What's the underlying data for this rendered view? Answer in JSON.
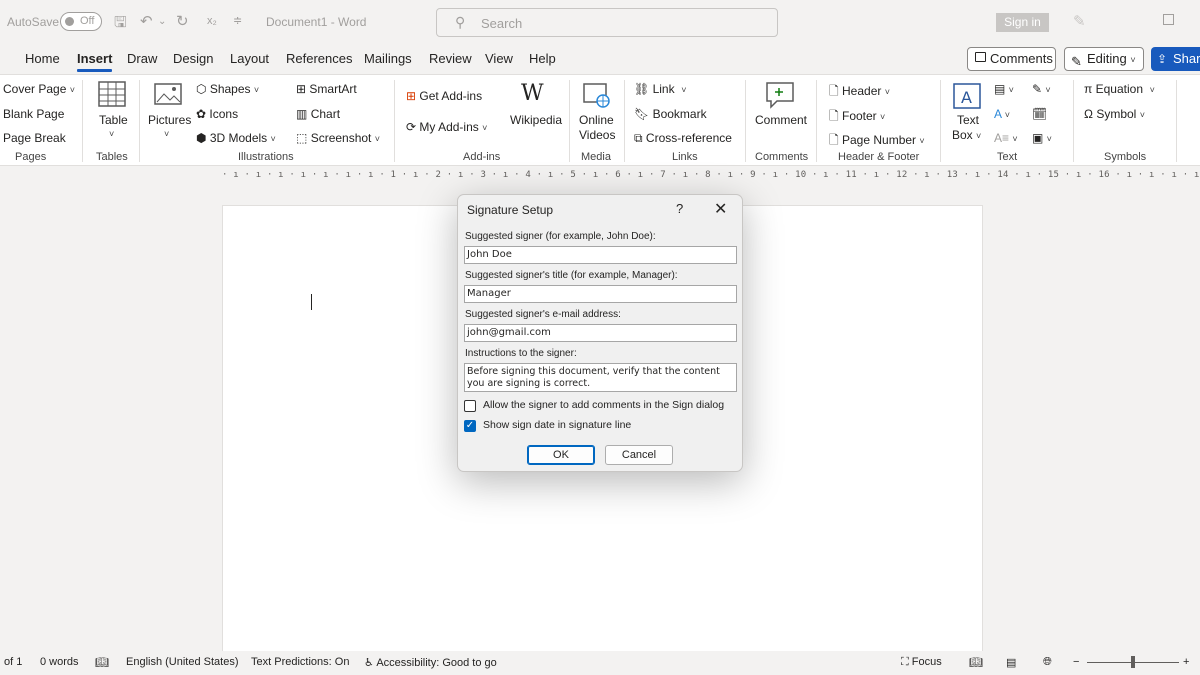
{
  "titlebar": {
    "autosave_label": "AutoSave",
    "autosave_state": "Off",
    "document_title": "Document1 - Word",
    "search_placeholder": "Search",
    "signin_label": "Sign in"
  },
  "tabs": [
    {
      "label": "Home"
    },
    {
      "label": "Insert",
      "active": true
    },
    {
      "label": "Draw"
    },
    {
      "label": "Design"
    },
    {
      "label": "Layout"
    },
    {
      "label": "References"
    },
    {
      "label": "Mailings"
    },
    {
      "label": "Review"
    },
    {
      "label": "View"
    },
    {
      "label": "Help"
    }
  ],
  "header_buttons": {
    "comments": "Comments",
    "editing": "Editing",
    "share": "Share"
  },
  "ribbon": {
    "pages": {
      "group": "Pages",
      "cover_page": "Cover Page",
      "blank_page": "Blank Page",
      "page_break": "Page Break"
    },
    "tables": {
      "group": "Tables",
      "table": "Table"
    },
    "illustrations": {
      "group": "Illustrations",
      "pictures": "Pictures",
      "shapes": "Shapes",
      "icons": "Icons",
      "models_3d": "3D Models",
      "smartart": "SmartArt",
      "chart": "Chart",
      "screenshot": "Screenshot"
    },
    "addins": {
      "group": "Add-ins",
      "get_addins": "Get Add-ins",
      "my_addins": "My Add-ins",
      "wikipedia": "Wikipedia"
    },
    "media": {
      "group": "Media",
      "online_videos_1": "Online",
      "online_videos_2": "Videos"
    },
    "links": {
      "group": "Links",
      "link": "Link",
      "bookmark": "Bookmark",
      "cross_reference": "Cross-reference"
    },
    "comments": {
      "group": "Comments",
      "comment": "Comment"
    },
    "header_footer": {
      "group": "Header & Footer",
      "header": "Header",
      "footer": "Footer",
      "page_number": "Page Number"
    },
    "text": {
      "group": "Text",
      "text_box_1": "Text",
      "text_box_2": "Box"
    },
    "symbols": {
      "group": "Symbols",
      "equation": "Equation",
      "symbol": "Symbol"
    }
  },
  "ruler": {
    "text": "· ı · ı · ı · ı · ı · ı · ı · 1 · ı · 2 · ı · 3 · ı · 4 · ı · 5 · ı · 6 · ı · 7 · ı · 8 · ı · 9 · ı · 10 · ı · 11 · ı · 12 · ı · 13 · ı · 14 · ı · 15 · ı · 16 · ı · ı · ı · ı"
  },
  "dialog": {
    "title": "Signature Setup",
    "help": "?",
    "close": "✕",
    "signer_label": "Suggested signer (for example, John Doe):",
    "signer_value": "John Doe",
    "title_label": "Suggested signer's title (for example, Manager):",
    "title_value": "Manager",
    "email_label": "Suggested signer's e-mail address:",
    "email_value": "john@gmail.com",
    "instructions_label": "Instructions to the signer:",
    "instructions_value": "Before signing this document, verify that the content you are signing is correct.",
    "allow_comments_label": "Allow the signer to add comments in the Sign dialog",
    "allow_comments_checked": false,
    "show_date_label": "Show sign date in signature line",
    "show_date_checked": true,
    "ok_label": "OK",
    "cancel_label": "Cancel"
  },
  "statusbar": {
    "page": "of 1",
    "words": "0 words",
    "language": "English (United States)",
    "text_predictions": "Text Predictions: On",
    "accessibility": "Accessibility: Good to go",
    "focus": "Focus",
    "zoom_minus": "−",
    "zoom_plus": "+"
  },
  "colors": {
    "accent": "#185abd",
    "checkbox": "#0067c0"
  }
}
